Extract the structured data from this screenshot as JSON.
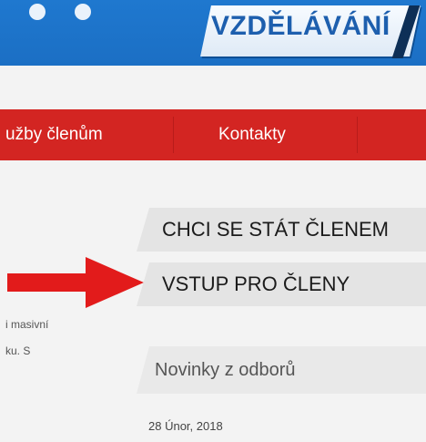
{
  "header": {
    "logo_text": "VZDĚLÁVÁNÍ",
    "brand_color": "#1f78cf"
  },
  "nav": {
    "items": [
      {
        "label": "užby členům"
      },
      {
        "label": "Kontakty"
      }
    ],
    "color": "#d32522"
  },
  "sidebar": {
    "join_label": "CHCI SE STÁT ČLENEM",
    "login_label": "VSTUP PRO ČLENY",
    "arrow_icon": "red-arrow-right-icon",
    "arrow_color": "#e21b1b"
  },
  "content": {
    "snippet_line1": "i masivní",
    "snippet_line2": "ku. S"
  },
  "news": {
    "title": "Novinky z odborů",
    "date": "28 Únor, 2018"
  }
}
